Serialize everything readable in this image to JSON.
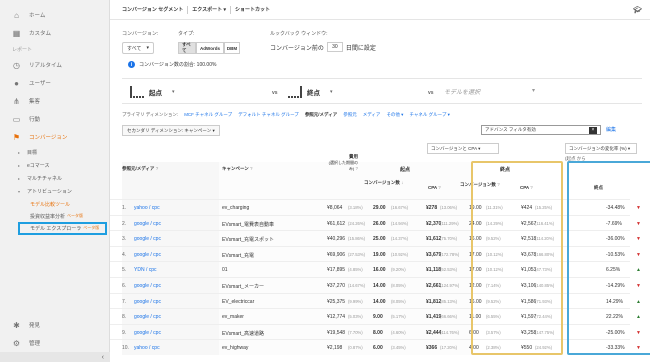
{
  "sidebar": {
    "items": [
      {
        "label": "ホーム",
        "icon": "home-icon"
      },
      {
        "label": "カスタム",
        "icon": "grid-icon"
      }
    ],
    "section_report": "レポート",
    "report_items": [
      {
        "label": "リアルタイム",
        "icon": "clock-icon"
      },
      {
        "label": "ユーザー",
        "icon": "person-icon"
      },
      {
        "label": "集客",
        "icon": "acquisition-icon"
      },
      {
        "label": "行動",
        "icon": "behavior-icon"
      },
      {
        "label": "コンバージョン",
        "icon": "flag-icon"
      }
    ],
    "conversion_sub": [
      "目標",
      "eコマース",
      "マルチチャネル",
      "アトリビューション"
    ],
    "attribution_sub": [
      {
        "label": "モデル比較ツール",
        "beta": ""
      },
      {
        "label": "投資収益率分析",
        "beta": "ベータ版"
      },
      {
        "label": "モデル エクスプローラ",
        "beta": "ベータ版"
      }
    ],
    "bottom_items": [
      {
        "label": "発見",
        "icon": "bulb-icon"
      },
      {
        "label": "管理",
        "icon": "gear-icon"
      }
    ],
    "collapse": "‹"
  },
  "toolbar": {
    "items": [
      "コンバージョン セグメント",
      "エクスポート ▾",
      "ショートカット"
    ]
  },
  "controls": {
    "conversion_label": "コンバージョン:",
    "conversion_value": "すべて",
    "type_label": "タイプ:",
    "type_options": [
      "すべて",
      "AdWords",
      "DBM"
    ],
    "lookback_label": "ルックバック ウィンドウ:",
    "lookback_prefix": "コンバージョン前の",
    "lookback_days": "30",
    "lookback_suffix": "日間に設定",
    "info_text": "コンバージョン数の割合: 100.00%"
  },
  "models": {
    "model1": "起点",
    "model2": "終点",
    "vs": "vs",
    "select_placeholder": "モデルを選択"
  },
  "dimensions": {
    "label": "プライマリ ディメンション:",
    "items": [
      "MCF チャネル グループ",
      "デフォルト チャネル グループ",
      "参照元/メディア",
      "参照元",
      "メディア",
      "その他 ▾",
      "チャネル グループ ▾"
    ],
    "current_index": 2,
    "secondary": "セカンダリ ディメンション: キャンペーン ▾",
    "filter": "アドバンス フィルタ有効",
    "edit": "編集"
  },
  "table": {
    "metric_dd": "コンバージョンと CPA ▾",
    "change_dd": "コンバージョンの変化率 (%) ▾",
    "change_sub": "(起点 から",
    "headers": {
      "source": "参照元/メディア",
      "campaign": "キャンペーン",
      "cost": "費用",
      "cost_sub": "(選択した期間のみ)",
      "band1": "起点",
      "band2": "終点",
      "conv": "コンバージョン数",
      "cpa": "CPA",
      "change": "終点"
    },
    "rows": [
      {
        "n": "1.",
        "src": "yahoo / cpc",
        "camp": "ev_charging",
        "cost": "¥8,064",
        "cost_p": "(3.18%)",
        "c1": "29.00",
        "c1p": "(16.67%)",
        "a1": "¥278",
        "a1p": "(13.06%)",
        "c2": "19.00",
        "c2p": "(11.31%)",
        "a2": "¥424",
        "a2p": "(15.25%)",
        "chg": "-34.48%",
        "dir": "down"
      },
      {
        "n": "2.",
        "src": "google / cpc",
        "camp": "EVsmart_電費表自動車",
        "cost": "¥61,612",
        "cost_p": "(24.26%)",
        "c1": "26.00",
        "c1p": "(14.94%)",
        "a1": "¥2,370",
        "a1p": "(111.29%)",
        "c2": "24.00",
        "c2p": "(14.29%)",
        "a2": "¥2,567",
        "a2p": "(116.41%)",
        "chg": "-7.69%",
        "dir": "down"
      },
      {
        "n": "3.",
        "src": "google / cpc",
        "camp": "EVsmart_充電スポット",
        "cost": "¥40,296",
        "cost_p": "(15.86%)",
        "c1": "25.00",
        "c1p": "(14.37%)",
        "a1": "¥1,612",
        "a1p": "(75.70%)",
        "c2": "16.00",
        "c2p": "(9.52%)",
        "a2": "¥2,518",
        "a2p": "(114.20%)",
        "chg": "-36.00%",
        "dir": "down"
      },
      {
        "n": "4.",
        "src": "google / cpc",
        "camp": "EVsmart_充電",
        "cost": "¥69,906",
        "cost_p": "(27.53%)",
        "c1": "19.00",
        "c1p": "(10.92%)",
        "a1": "¥3,679",
        "a1p": "(172.78%)",
        "c2": "17.00",
        "c2p": "(10.12%)",
        "a2": "¥3,678",
        "a2p": "(166.80%)",
        "chg": "-10.53%",
        "dir": "down"
      },
      {
        "n": "5.",
        "src": "YDN / cpc",
        "camp": "01",
        "cost": "¥17,895",
        "cost_p": "(4.85%)",
        "c1": "16.00",
        "c1p": "(9.20%)",
        "a1": "¥1,118",
        "a1p": "(52.53%)",
        "c2": "17.00",
        "c2p": "(10.12%)",
        "a2": "¥1,053",
        "a2p": "(47.73%)",
        "chg": "6.25%",
        "dir": "up"
      },
      {
        "n": "6.",
        "src": "google / cpc",
        "camp": "EVsmart_メーカー",
        "cost": "¥37,270",
        "cost_p": "(14.67%)",
        "c1": "14.00",
        "c1p": "(8.05%)",
        "a1": "¥2,661",
        "a1p": "(124.97%)",
        "c2": "12.00",
        "c2p": "(7.14%)",
        "a2": "¥3,106",
        "a2p": "(140.85%)",
        "chg": "-14.29%",
        "dir": "down"
      },
      {
        "n": "7.",
        "src": "google / cpc",
        "camp": "EV_electriccar",
        "cost": "¥25,375",
        "cost_p": "(9.99%)",
        "c1": "14.00",
        "c1p": "(8.05%)",
        "a1": "¥1,812",
        "a1p": "(85.13%)",
        "c2": "16.00",
        "c2p": "(9.52%)",
        "a2": "¥1,586",
        "a2p": "(71.93%)",
        "chg": "14.29%",
        "dir": "up"
      },
      {
        "n": "8.",
        "src": "google / cpc",
        "camp": "ev_maker",
        "cost": "¥12,774",
        "cost_p": "(5.03%)",
        "c1": "9.00",
        "c1p": "(5.17%)",
        "a1": "¥1,419",
        "a1p": "(66.66%)",
        "c2": "11.00",
        "c2p": "(6.55%)",
        "a2": "¥1,597",
        "a2p": "(72.44%)",
        "chg": "22.22%",
        "dir": "up"
      },
      {
        "n": "9.",
        "src": "google / cpc",
        "camp": "EVsmart_高速道路",
        "cost": "¥19,548",
        "cost_p": "(7.70%)",
        "c1": "8.00",
        "c1p": "(4.60%)",
        "a1": "¥2,444",
        "a1p": "(114.76%)",
        "c2": "6.00",
        "c2p": "(3.57%)",
        "a2": "¥3,258",
        "a2p": "(147.75%)",
        "chg": "-25.00%",
        "dir": "down"
      },
      {
        "n": "10.",
        "src": "yahoo / cpc",
        "camp": "ev_highway",
        "cost": "¥2,198",
        "cost_p": "(0.87%)",
        "c1": "6.00",
        "c1p": "(3.45%)",
        "a1": "¥366",
        "a1p": "(17.20%)",
        "c2": "4.00",
        "c2p": "(2.38%)",
        "a2": "¥550",
        "a2p": "(24.92%)",
        "chg": "-33.33%",
        "dir": "down"
      }
    ]
  }
}
